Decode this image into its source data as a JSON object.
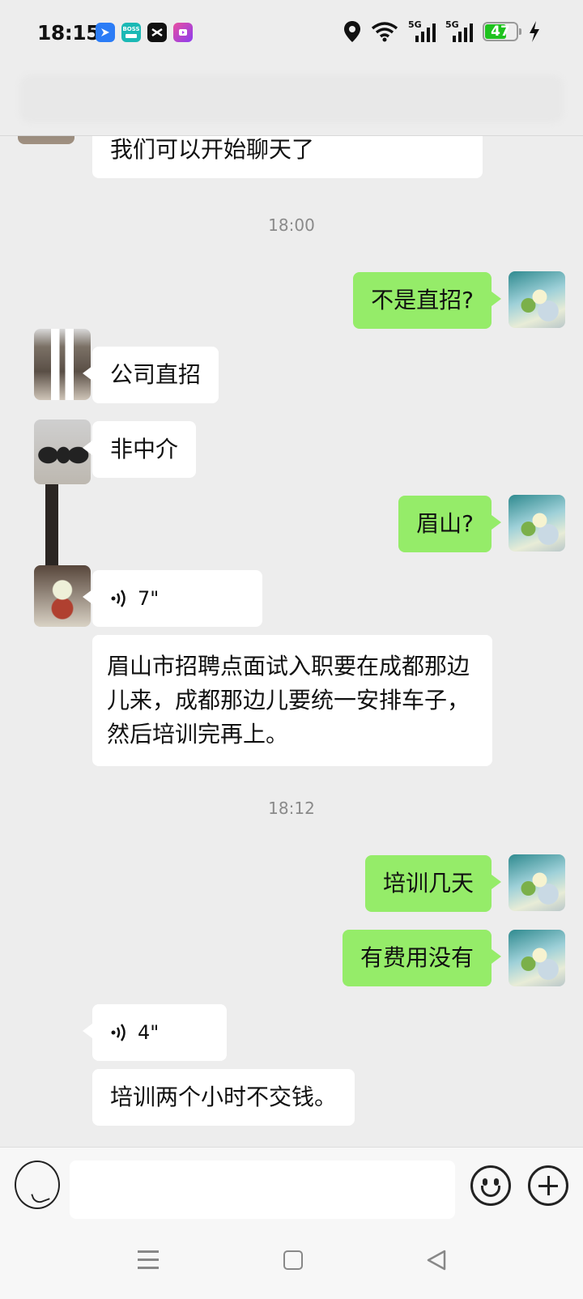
{
  "status_bar": {
    "time": "18:15",
    "app_icons": [
      {
        "name": "feishu-icon",
        "label": "",
        "color": "#2b7cf6"
      },
      {
        "name": "boss-zhipin-icon",
        "label": "BOSS",
        "color": "#1bb9b5"
      },
      {
        "name": "capcut-icon",
        "label": "",
        "color": "#111111"
      },
      {
        "name": "video-app-icon",
        "label": "",
        "color": "#b33cf0"
      }
    ],
    "signals": [
      "5G",
      "5G"
    ],
    "battery_level": "47",
    "battery_color": "#1ec21e"
  },
  "chat": {
    "messages": [
      {
        "id": "m0",
        "side": "in",
        "type": "text",
        "text": "我们可以开始聊天了"
      },
      {
        "id": "t1",
        "type": "timestamp",
        "text": "18:00"
      },
      {
        "id": "m1",
        "side": "out",
        "type": "text",
        "text": "不是直招?"
      },
      {
        "id": "m2",
        "side": "in",
        "type": "text",
        "text": "公司直招"
      },
      {
        "id": "m3",
        "side": "in",
        "type": "text",
        "text": "非中介"
      },
      {
        "id": "m4",
        "side": "out",
        "type": "text",
        "text": "眉山?"
      },
      {
        "id": "m5",
        "side": "in",
        "type": "voice",
        "duration": "7\""
      },
      {
        "id": "m6",
        "side": "in",
        "type": "text",
        "text": "眉山市招聘点面试入职要在成都那边儿来，成都那边儿要统一安排车子，然后培训完再上。"
      },
      {
        "id": "t2",
        "type": "timestamp",
        "text": "18:12"
      },
      {
        "id": "m7",
        "side": "out",
        "type": "text",
        "text": "培训几天"
      },
      {
        "id": "m8",
        "side": "out",
        "type": "text",
        "text": "有费用没有"
      },
      {
        "id": "m9",
        "side": "in",
        "type": "voice",
        "duration": "4\""
      },
      {
        "id": "m10",
        "side": "in",
        "type": "text",
        "text": "培训两个小时不交钱。"
      }
    ],
    "colors": {
      "outgoing_bubble": "#95ec69",
      "incoming_bubble": "#ffffff",
      "background": "#ededed"
    }
  },
  "input_bar": {
    "text_value": "",
    "icons": [
      "voice-toggle-icon",
      "emoji-icon",
      "plus-icon"
    ]
  },
  "nav_bar": {
    "icons": [
      "menu-icon",
      "home-icon",
      "back-icon"
    ]
  }
}
